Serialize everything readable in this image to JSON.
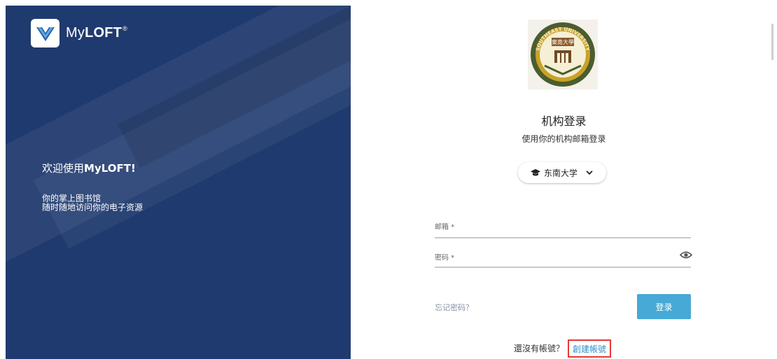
{
  "brand": {
    "name_pre": "My",
    "name_bold": "LOFT",
    "name_sup": "®"
  },
  "left": {
    "welcome_pre": "欢迎使用",
    "welcome_bold": "MyLOFT!",
    "tagline_line1": "你的掌上图书馆",
    "tagline_line2": "随时随地访问你的电子资源"
  },
  "login": {
    "title": "机构登录",
    "subtitle": "使用你的机构邮箱登录",
    "institution": "东南大学",
    "email_label": "邮箱 *",
    "email_value": "",
    "password_label": "密码 *",
    "password_value": "",
    "forgot_label": "忘记密码？",
    "login_button": "登录",
    "no_account_text": "還沒有帳號？",
    "create_account_label": "創建帳號"
  },
  "emblem": {
    "seal_text_top": "SOUTHEAST UNIVERSITY",
    "seal_text_center": "東南大學"
  },
  "colors": {
    "left_panel": "#1f3a6e",
    "login_button": "#47a9d6",
    "link": "#2f8fc9",
    "highlight_border": "#e53935"
  }
}
